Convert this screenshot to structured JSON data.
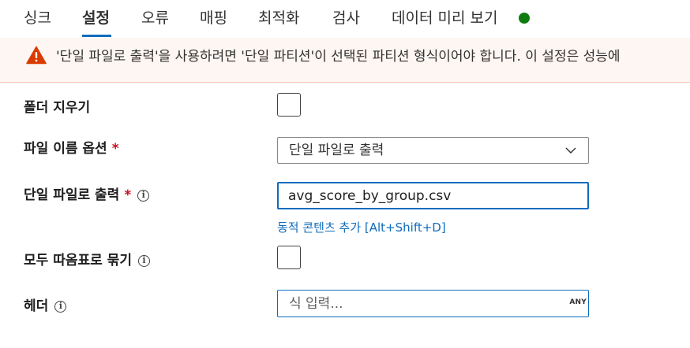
{
  "tabs": [
    {
      "label": "싱크"
    },
    {
      "label": "설정"
    },
    {
      "label": "오류"
    },
    {
      "label": "매핑"
    },
    {
      "label": "최적화"
    },
    {
      "label": "검사"
    },
    {
      "label": "데이터 미리 보기"
    }
  ],
  "active_tab": "설정",
  "status_color": "#107c10",
  "warning": {
    "icon": "warning-triangle-icon",
    "text": "'단일 파일로 출력'을 사용하려면 '단일 파티션'이 선택된 파티션 형식이어야 합니다. 이 설정은 성능에"
  },
  "form": {
    "clear_folder": {
      "label": "폴더 지우기",
      "checked": false
    },
    "file_name_option": {
      "label": "파일 이름 옵션",
      "required_mark": "*",
      "value": "단일 파일로 출력"
    },
    "output_single_file": {
      "label": "단일 파일로 출력",
      "required_mark": "*",
      "value": "avg_score_by_group.csv",
      "dynamic_link": "동적 콘텐츠 추가 [Alt+Shift+D]"
    },
    "quote_all": {
      "label": "모두 따옴표로 묶기",
      "checked": false
    },
    "header": {
      "label": "헤더",
      "placeholder": "식 입력...",
      "badge": "ANY"
    }
  },
  "colors": {
    "accent": "#0f6cbd",
    "warning_bg": "#fdf6f3",
    "warning_icon": "#da3b01",
    "required": "#c50f1f"
  }
}
